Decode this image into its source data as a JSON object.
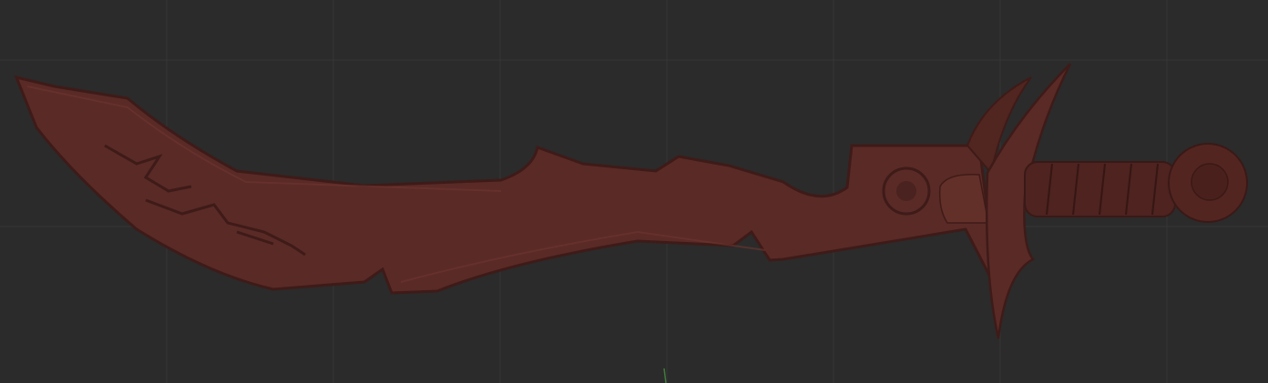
{
  "viewport": {
    "background_color": "#2b2b2b",
    "grid_color": "#363636",
    "axis_color": "#3f7a3a"
  },
  "model": {
    "name_parts": [
      "blade",
      "crossguard",
      "grip",
      "pommel"
    ],
    "material_color": "#5a2a26",
    "shadow_color": "#3e1b18",
    "highlight_color": "#6e3631"
  }
}
